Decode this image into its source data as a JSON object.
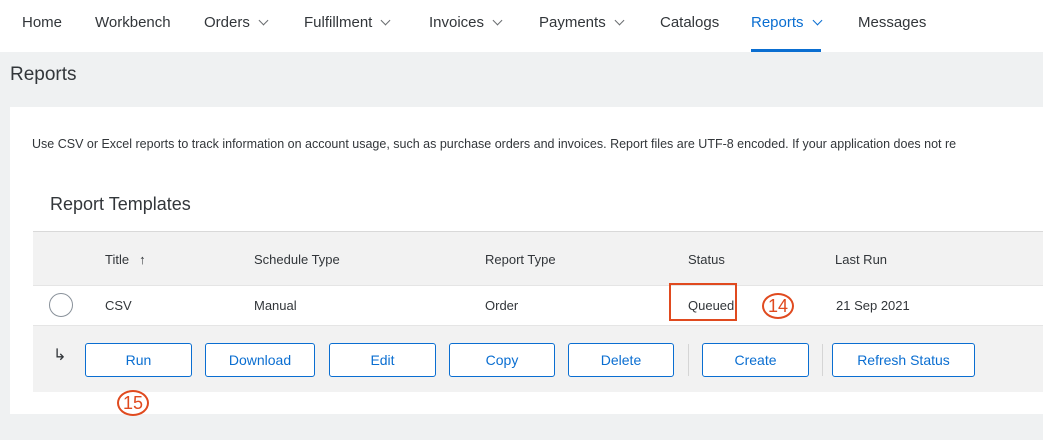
{
  "nav": {
    "items": [
      {
        "label": "Home",
        "dropdown": false,
        "active": false
      },
      {
        "label": "Workbench",
        "dropdown": false,
        "active": false
      },
      {
        "label": "Orders",
        "dropdown": true,
        "active": false
      },
      {
        "label": "Fulfillment",
        "dropdown": true,
        "active": false
      },
      {
        "label": "Invoices",
        "dropdown": true,
        "active": false
      },
      {
        "label": "Payments",
        "dropdown": true,
        "active": false
      },
      {
        "label": "Catalogs",
        "dropdown": false,
        "active": false
      },
      {
        "label": "Reports",
        "dropdown": true,
        "active": true
      },
      {
        "label": "Messages",
        "dropdown": false,
        "active": false
      }
    ]
  },
  "page": {
    "title": "Reports",
    "description": "Use CSV or Excel reports to track information on account usage, such as purchase orders and invoices. Report files are UTF-8 encoded. If your application does not re"
  },
  "templates": {
    "section_title": "Report Templates",
    "columns": {
      "title": "Title",
      "sort_icon": "↑",
      "schedule_type": "Schedule Type",
      "report_type": "Report Type",
      "status": "Status",
      "last_run": "Last Run"
    },
    "rows": [
      {
        "title": "CSV",
        "schedule_type": "Manual",
        "report_type": "Order",
        "status": "Queued",
        "last_run": "21 Sep 2021"
      }
    ]
  },
  "actions": {
    "arrow_icon": "↳",
    "run": "Run",
    "download": "Download",
    "edit": "Edit",
    "copy": "Copy",
    "delete": "Delete",
    "create": "Create",
    "refresh": "Refresh Status"
  },
  "callouts": {
    "status": "14",
    "run": "15"
  },
  "colors": {
    "accent": "#0a6ed1",
    "callout": "#e04a1f"
  }
}
